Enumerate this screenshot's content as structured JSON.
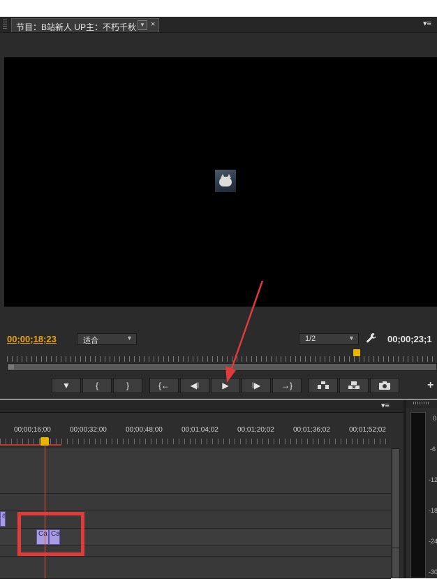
{
  "monitor": {
    "tab_title": "节目：B站新人 UP主：不朽千秋",
    "tab_dropdown_icon": "▼",
    "tab_close": "×",
    "panel_menu": "▾≡",
    "current_timecode": "00;00;18;23",
    "fit": "适合",
    "resolution": "1/2",
    "duration_timecode": "00;00;23;1",
    "add_button": "+"
  },
  "transport": {
    "marker": "▼",
    "mark_in": "{",
    "mark_out": "}",
    "goto_in": "{←",
    "step_back": "◀I",
    "play": "▶",
    "step_forward": "I▶",
    "goto_out": "→}",
    "lift": "lift-icon",
    "extract": "extract-icon",
    "export_frame": "camera-icon"
  },
  "timeline": {
    "panel_menu": "▾≡",
    "ruler": [
      "00;00;16;00",
      "00;00;32;00",
      "00;00;48;00",
      "00;01;04;02",
      "00;01;20;02",
      "00;01;36;02",
      "00;01;52;02"
    ],
    "clips": {
      "left": "a",
      "ca1": "Ca",
      "ca2": "Ca"
    }
  },
  "meter": {
    "scale": [
      "0",
      "-6",
      "-12",
      "-18",
      "-24",
      "-30"
    ]
  },
  "colors": {
    "timecode_accent": "#e8a317",
    "playhead": "#e8b500",
    "annotation_red": "#e03a3a",
    "clip_fill": "#a89ce0"
  }
}
